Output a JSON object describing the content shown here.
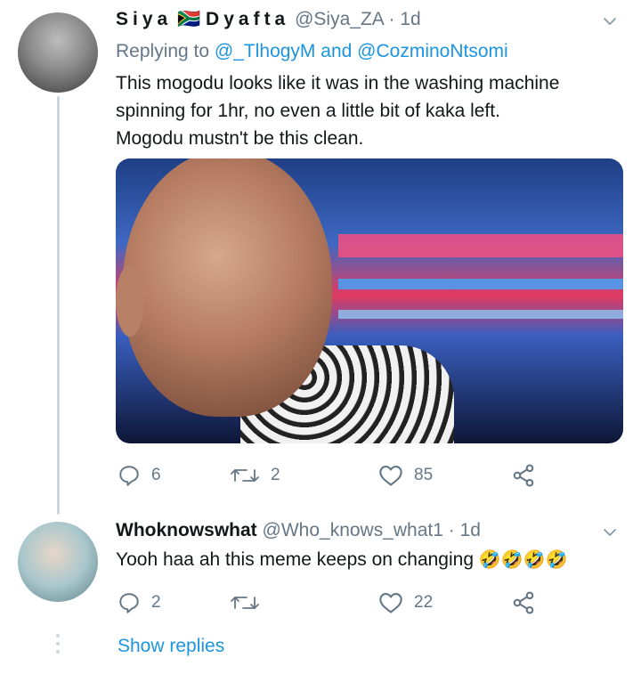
{
  "tweets": [
    {
      "display_name": "Siya",
      "flag": "🇿🇦",
      "display_name_2": "Dyafta",
      "handle": "@Siya_ZA",
      "separator": "·",
      "time": "1d",
      "replying_prefix": "Replying to",
      "replying_to_1": "@_TlhogyM",
      "replying_and": "and",
      "replying_to_2": "@CozminoNtsomi",
      "text_lines": [
        "This mogodu looks like it was in the washing machine",
        "spinning for 1hr,  no even a little bit of kaka left.",
        "Mogodu mustn't be this clean."
      ],
      "replies": "6",
      "retweets": "2",
      "likes": "85"
    },
    {
      "display_name": "Whoknowswhat",
      "handle": "@Who_knows_what1",
      "separator": "·",
      "time": "1d",
      "text": "Yooh haa ah this meme keeps on changing ",
      "emojis": "🤣🤣🤣🤣",
      "replies": "2",
      "retweets": "",
      "likes": "22"
    }
  ],
  "show_replies": "Show replies",
  "icons": {
    "reply": "reply-icon",
    "retweet": "retweet-icon",
    "like": "heart-icon",
    "share": "share-icon",
    "more": "chevron-down-icon"
  },
  "colors": {
    "text": "#14171a",
    "secondary": "#657786",
    "link": "#1b95e0",
    "line": "#ccd6dd"
  }
}
